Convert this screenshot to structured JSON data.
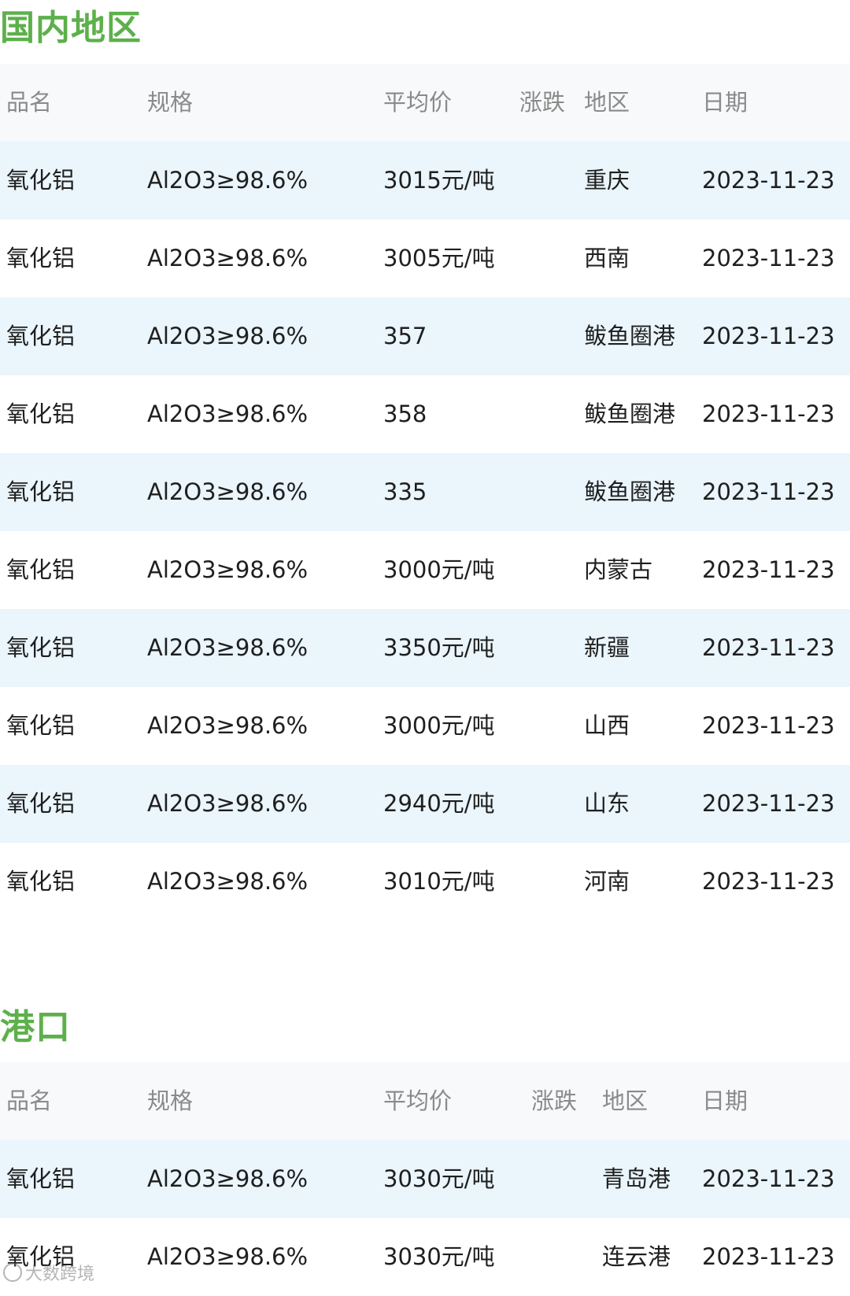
{
  "domestic": {
    "title": "国内地区",
    "headers": {
      "name": "品名",
      "spec": "规格",
      "price": "平均价",
      "change": "涨跌",
      "region": "地区",
      "date": "日期"
    },
    "rows": [
      {
        "name": "氧化铝",
        "spec": "Al2O3≥98.6%",
        "price": "3015元/吨",
        "change": "",
        "region": "重庆",
        "date": "2023-11-23"
      },
      {
        "name": "氧化铝",
        "spec": "Al2O3≥98.6%",
        "price": "3005元/吨",
        "change": "",
        "region": "西南",
        "date": "2023-11-23"
      },
      {
        "name": "氧化铝",
        "spec": "Al2O3≥98.6%",
        "price": "357",
        "change": "",
        "region": "鲅鱼圈港",
        "date": "2023-11-23"
      },
      {
        "name": "氧化铝",
        "spec": "Al2O3≥98.6%",
        "price": "358",
        "change": "",
        "region": "鲅鱼圈港",
        "date": "2023-11-23"
      },
      {
        "name": "氧化铝",
        "spec": "Al2O3≥98.6%",
        "price": "335",
        "change": "",
        "region": "鲅鱼圈港",
        "date": "2023-11-23"
      },
      {
        "name": "氧化铝",
        "spec": "Al2O3≥98.6%",
        "price": "3000元/吨",
        "change": "",
        "region": "内蒙古",
        "date": "2023-11-23"
      },
      {
        "name": "氧化铝",
        "spec": "Al2O3≥98.6%",
        "price": "3350元/吨",
        "change": "",
        "region": "新疆",
        "date": "2023-11-23"
      },
      {
        "name": "氧化铝",
        "spec": "Al2O3≥98.6%",
        "price": "3000元/吨",
        "change": "",
        "region": "山西",
        "date": "2023-11-23"
      },
      {
        "name": "氧化铝",
        "spec": "Al2O3≥98.6%",
        "price": "2940元/吨",
        "change": "",
        "region": "山东",
        "date": "2023-11-23"
      },
      {
        "name": "氧化铝",
        "spec": "Al2O3≥98.6%",
        "price": "3010元/吨",
        "change": "",
        "region": "河南",
        "date": "2023-11-23"
      }
    ]
  },
  "port": {
    "title": "港口",
    "headers": {
      "name": "品名",
      "spec": "规格",
      "price": "平均价",
      "change": "涨跌",
      "region": "地区",
      "date": "日期"
    },
    "rows": [
      {
        "name": "氧化铝",
        "spec": "Al2O3≥98.6%",
        "price": "3030元/吨",
        "change": "",
        "region": "青岛港",
        "date": "2023-11-23"
      },
      {
        "name": "氧化铝",
        "spec": "Al2O3≥98.6%",
        "price": "3030元/吨",
        "change": "",
        "region": "连云港",
        "date": "2023-11-23"
      }
    ]
  },
  "watermark": "大数跨境",
  "colors": {
    "title_green": "#5db04b",
    "row_alt": "#eaf5fc",
    "header_bg": "#f7f9fb",
    "header_text": "#8a8a8a"
  }
}
